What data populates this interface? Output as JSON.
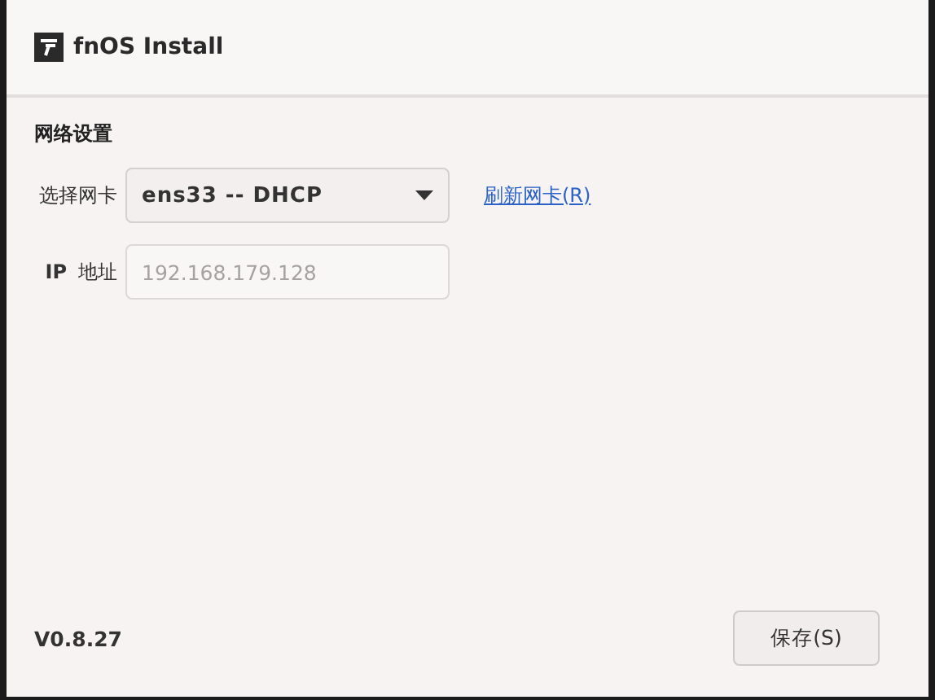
{
  "window": {
    "title": "fnOS Install"
  },
  "section_title": "网络设置",
  "nic": {
    "label": "选择网卡",
    "value": "ens33 -- DHCP"
  },
  "refresh_link": "刷新网卡(R)",
  "ip": {
    "label_prefix": "IP",
    "label": "地址",
    "placeholder": "192.168.179.128"
  },
  "version": "V0.8.27",
  "buttons": [
    "保存(S)"
  ]
}
